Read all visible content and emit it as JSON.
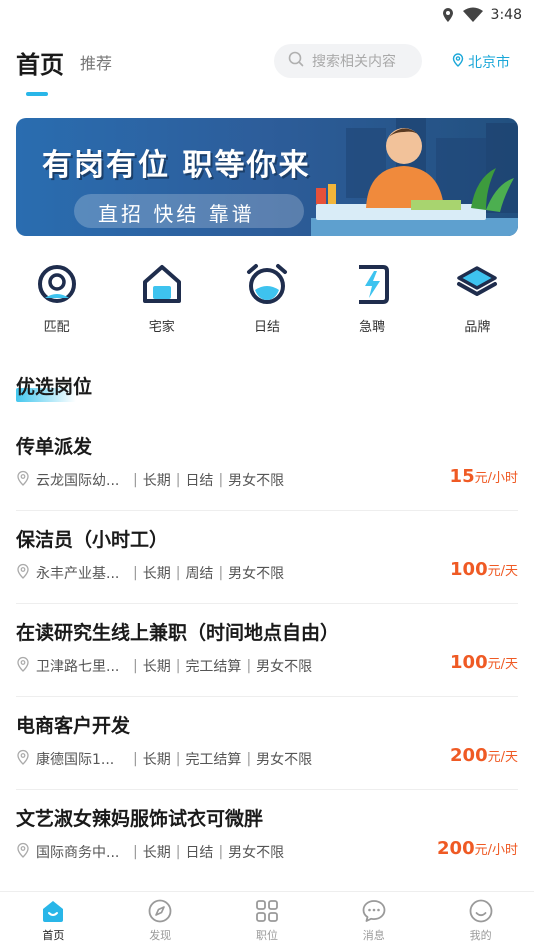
{
  "status_bar": {
    "time": "3:48"
  },
  "header": {
    "tab_home": "首页",
    "tab_recommend": "推荐",
    "search_placeholder": "搜索相关内容",
    "city": "北京市"
  },
  "banner": {
    "title": "有岗有位 职等你来",
    "subtitle": "直招 快结 靠谱"
  },
  "categories": [
    {
      "label": "匹配",
      "icon": "target-icon"
    },
    {
      "label": "宅家",
      "icon": "home-icon"
    },
    {
      "label": "日结",
      "icon": "alarm-clock-icon"
    },
    {
      "label": "急聘",
      "icon": "lightning-icon"
    },
    {
      "label": "品牌",
      "icon": "layers-icon"
    }
  ],
  "section_title": "优选岗位",
  "jobs": [
    {
      "title": "传单派发",
      "location": "云龙国际幼...",
      "term": "长期",
      "settle": "日结",
      "gender": "男女不限",
      "pay": "15",
      "unit": "元/小时"
    },
    {
      "title": "保洁员（小时工）",
      "location": "永丰产业基...",
      "term": "长期",
      "settle": "周结",
      "gender": "男女不限",
      "pay": "100",
      "unit": "元/天"
    },
    {
      "title": "在读研究生线上兼职（时间地点自由）",
      "location": "卫津路七里...",
      "term": "长期",
      "settle": "完工结算",
      "gender": "男女不限",
      "pay": "100",
      "unit": "元/天"
    },
    {
      "title": "电商客户开发",
      "location": "康德国际1...",
      "term": "长期",
      "settle": "完工结算",
      "gender": "男女不限",
      "pay": "200",
      "unit": "元/天"
    },
    {
      "title": "文艺淑女辣妈服饰试衣可微胖",
      "location": "国际商务中...",
      "term": "长期",
      "settle": "日结",
      "gender": "男女不限",
      "pay": "200",
      "unit": "元/小时"
    }
  ],
  "tabbar": [
    {
      "label": "首页",
      "icon": "home-smile-icon",
      "active": true
    },
    {
      "label": "发现",
      "icon": "compass-icon",
      "active": false
    },
    {
      "label": "职位",
      "icon": "grid-icon",
      "active": false
    },
    {
      "label": "消息",
      "icon": "chat-bubble-icon",
      "active": false
    },
    {
      "label": "我的",
      "icon": "smiley-icon",
      "active": false
    }
  ],
  "colors": {
    "accent": "#29b6e8",
    "price": "#ef5a24"
  }
}
